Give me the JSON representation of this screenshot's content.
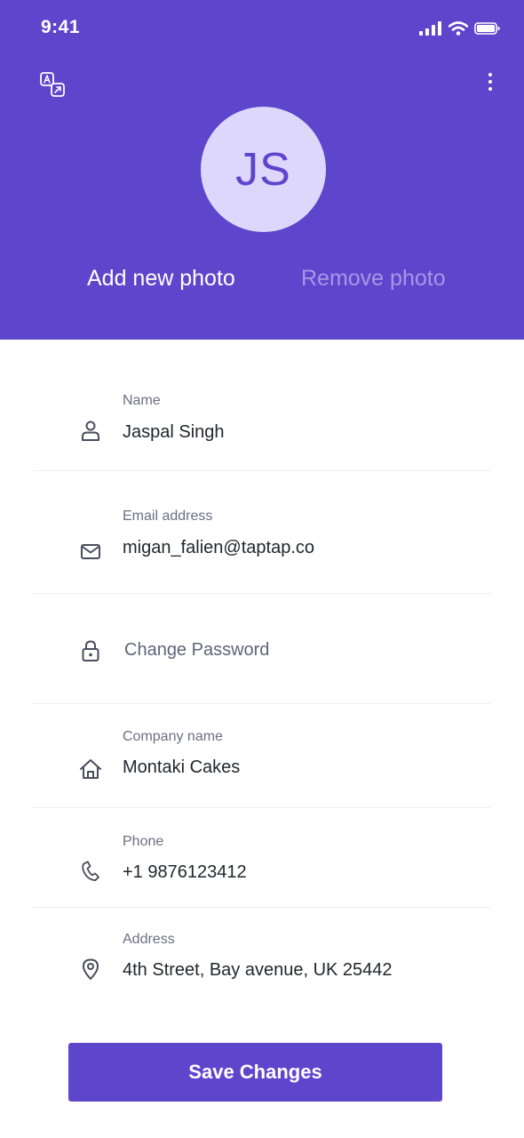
{
  "status_bar": {
    "time": "9:41",
    "icons": [
      "signal-icon",
      "wifi-icon",
      "battery-icon"
    ]
  },
  "header": {
    "background": "#5E46CC",
    "left_action_icon": "translate-icon",
    "right_action_icon": "more-vertical-icon",
    "avatar_initials": "JS",
    "add_photo_label": "Add new photo",
    "remove_photo_label": "Remove photo"
  },
  "fields": {
    "name": {
      "label": "Name",
      "value": "Jaspal Singh",
      "icon": "user-icon"
    },
    "email": {
      "label": "Email address",
      "value": "migan_falien@taptap.co",
      "icon": "mail-icon"
    },
    "password": {
      "label": "Change Password",
      "icon": "lock-icon"
    },
    "company": {
      "label": "Company name",
      "value": "Montaki Cakes",
      "icon": "home-icon"
    },
    "phone": {
      "label": "Phone",
      "value": "+1  9876123412",
      "icon": "phone-icon"
    },
    "address": {
      "label": "Address",
      "value": "4th Street, Bay avenue, UK 25442",
      "icon": "location-icon"
    }
  },
  "save_button": {
    "label": "Save Changes"
  },
  "colors": {
    "accent": "#5E46CC",
    "avatar_bg": "#DCD7FB",
    "muted_text": "#A596E8"
  }
}
